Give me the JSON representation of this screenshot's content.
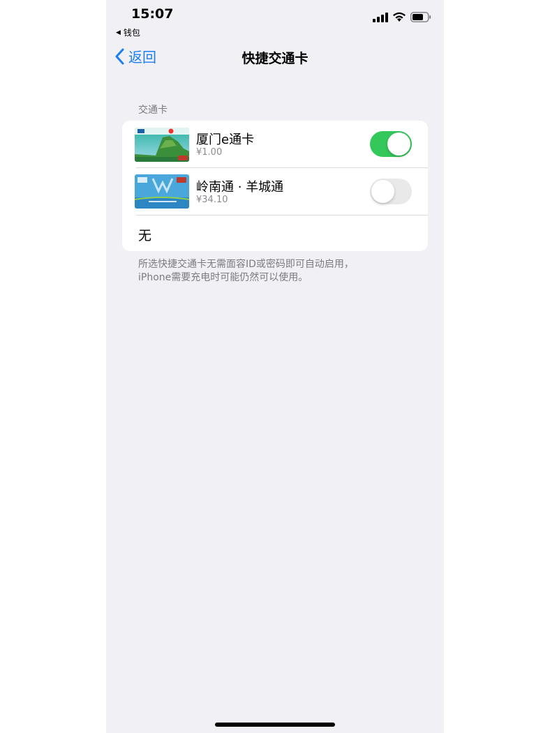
{
  "status_bar": {
    "time": "15:07",
    "back_app": "钱包",
    "icons": [
      "signal-icon",
      "wifi-icon",
      "battery-icon"
    ]
  },
  "nav": {
    "back_label": "返回",
    "title": "快捷交通卡"
  },
  "section": {
    "header": "交通卡",
    "cards": [
      {
        "name": "厦门e通卡",
        "balance": "¥1.00",
        "enabled": true
      },
      {
        "name": "岭南通 · 羊城通",
        "balance": "¥34.10",
        "enabled": false
      }
    ],
    "none_label": "无"
  },
  "footer": {
    "line1": "所选快捷交通卡无需面容ID或密码即可自动启用，",
    "line2": "iPhone需要充电时可能仍然可以使用。"
  },
  "colors": {
    "accent": "#1a7ef5",
    "toggle_on": "#34c759",
    "background": "#f0f0f5"
  }
}
